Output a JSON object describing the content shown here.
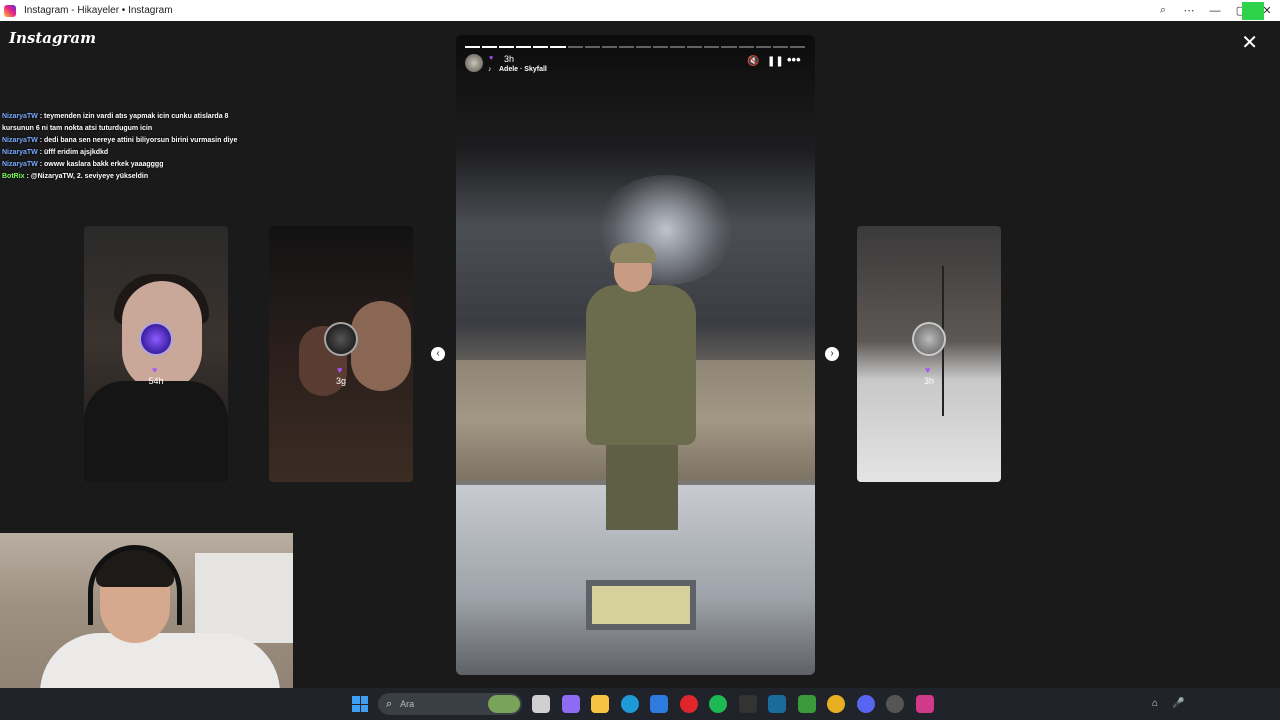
{
  "window": {
    "title": "Instagram - Hikayeler • Instagram",
    "controls": {
      "zoom": "⌕",
      "more": "⋯",
      "minimize": "—",
      "maximize": "▢",
      "close": "✕"
    }
  },
  "page": {
    "logo": "Instagram",
    "close_icon": "✕"
  },
  "chat": [
    {
      "user": "NizaryaTW",
      "text": " : teymenden izin vardi atıs yapmak icin cunku atislarda 8 kursunun 6 ni tam nokta atsi tuturdugum icin"
    },
    {
      "user": "NizaryaTW",
      "text": " : dedi bana sen nereye attini biliyorsun birini vurmasin diye"
    },
    {
      "user": "NizaryaTW",
      "text": " : üfff eridim ajsjkdkd"
    },
    {
      "user": "NizaryaTW",
      "text": " : owww kaslara bakk erkek yaaagggg"
    },
    {
      "user": "BotRix",
      "text": " : @NizaryaTW, 2. seviyeye yükseldin",
      "bot": true
    }
  ],
  "thumbnails": [
    {
      "time": "54h"
    },
    {
      "time": "3g"
    },
    {
      "time": "3h"
    }
  ],
  "nav": {
    "prev": "‹",
    "next": "›"
  },
  "story": {
    "time": "3h",
    "music": "Adele · Skyfall",
    "progress": {
      "total": 20,
      "done": 6
    },
    "icons": {
      "mute": "🔇",
      "pause": "❚❚",
      "more": "•••",
      "music": "♪",
      "heart": "♥"
    }
  },
  "taskbar": {
    "search_placeholder": "Ara",
    "search_icon": "⌕",
    "apps": [
      {
        "name": "task-view",
        "color": "#d0d0d0"
      },
      {
        "name": "copilot",
        "color": "#8b6cf2"
      },
      {
        "name": "file-explorer",
        "color": "#f5c242"
      },
      {
        "name": "edge",
        "color": "#1e9ad6"
      },
      {
        "name": "store",
        "color": "#2e7be0"
      },
      {
        "name": "opera",
        "color": "#e0262b"
      },
      {
        "name": "spotify",
        "color": "#1db954"
      },
      {
        "name": "epic-games",
        "color": "#333333"
      },
      {
        "name": "steam",
        "color": "#1b6a9c"
      },
      {
        "name": "b-app",
        "color": "#3a9a3a"
      },
      {
        "name": "chrome",
        "color": "#e8b021"
      },
      {
        "name": "discord",
        "color": "#5865f2"
      },
      {
        "name": "obs",
        "color": "#555555"
      },
      {
        "name": "instagram",
        "color": "#d13a8a"
      }
    ],
    "tray": {
      "icon1": "⌂",
      "icon2": "🎤"
    }
  }
}
